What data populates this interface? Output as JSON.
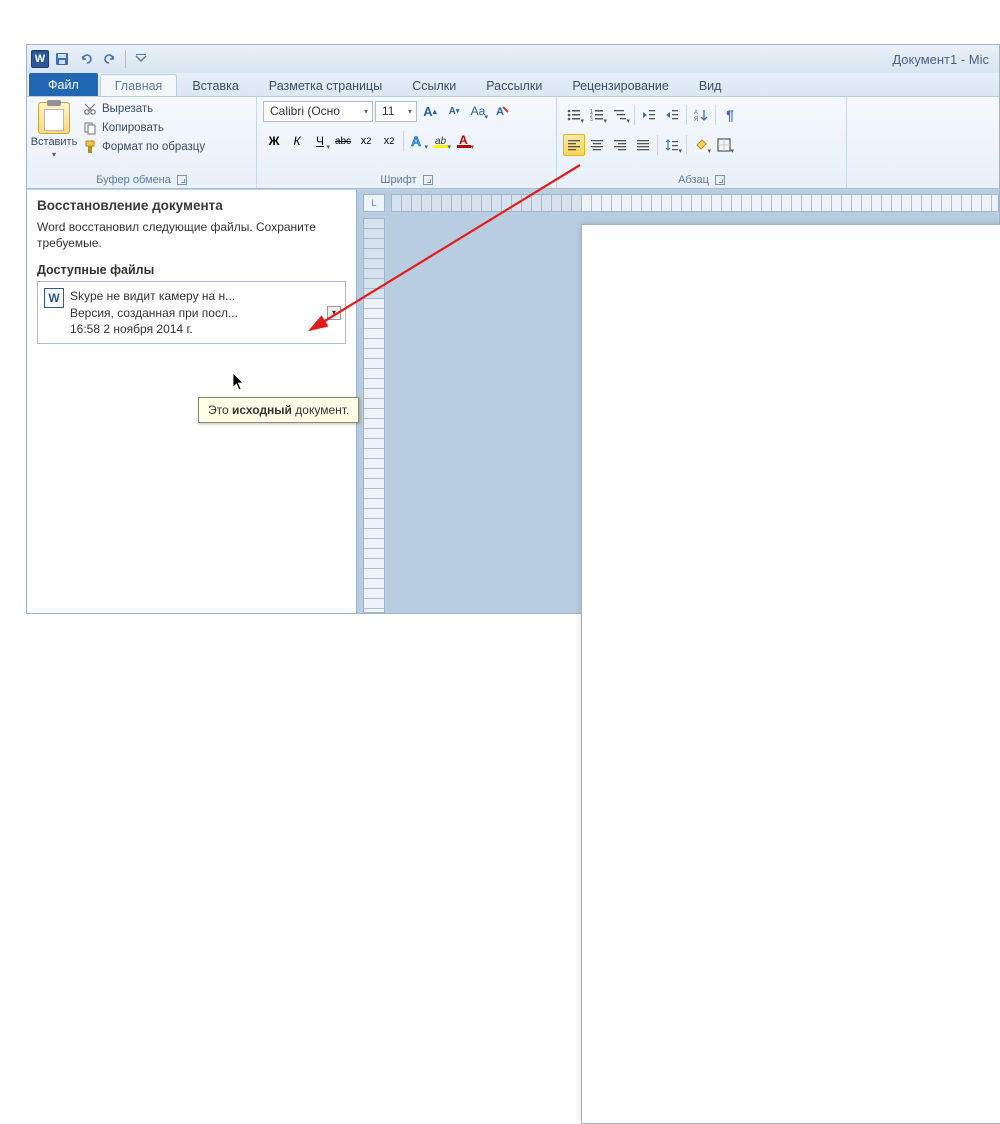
{
  "window": {
    "title": "Документ1 - Mic"
  },
  "qat": {
    "save_tip": "Сохранить",
    "undo_tip": "Отменить",
    "redo_tip": "Вернуть"
  },
  "tabs": {
    "file": "Файл",
    "home": "Главная",
    "insert": "Вставка",
    "layout": "Разметка страницы",
    "refs": "Ссылки",
    "mail": "Рассылки",
    "review": "Рецензирование",
    "view": "Вид"
  },
  "clipboard": {
    "paste": "Вставить",
    "cut": "Вырезать",
    "copy": "Копировать",
    "format_painter": "Формат по образцу",
    "group_label": "Буфер обмена"
  },
  "font": {
    "name": "Calibri (Осно",
    "size": "11",
    "group_label": "Шрифт",
    "bold": "Ж",
    "italic": "К",
    "underline": "Ч",
    "strike": "abc",
    "sub": "x₂",
    "sup": "x²",
    "grow": "A",
    "shrink": "A",
    "case": "Aa",
    "clear": "A"
  },
  "paragraph": {
    "group_label": "Абзац"
  },
  "recovery": {
    "title": "Восстановление документа",
    "desc": "Word восстановил следующие файлы. Сохраните требуемые.",
    "section": "Доступные файлы",
    "item_title": "Skype не видит камеру на н...",
    "item_line2": "Версия, созданная при посл...",
    "item_line3": "16:58 2 ноября 2014 г."
  },
  "tooltip": {
    "prefix": "Это ",
    "bold": "исходный",
    "suffix": " документ."
  },
  "ruler_corner": "L"
}
